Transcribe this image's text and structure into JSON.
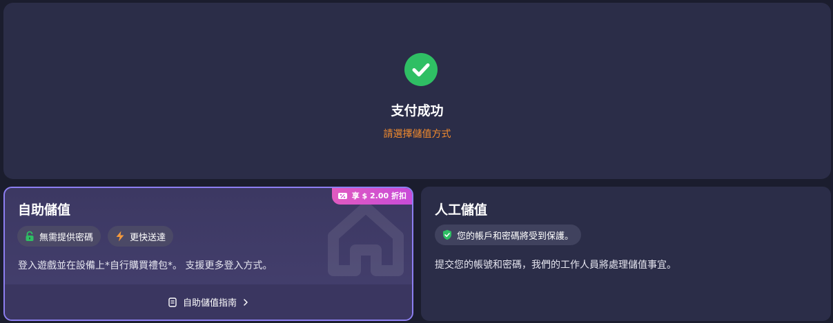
{
  "status": {
    "title": "支付成功",
    "subtitle": "請選擇儲值方式",
    "icon": "check-circle-icon",
    "success_color": "#2fbf64",
    "subtitle_color": "#f28b2e"
  },
  "self_topup": {
    "title": "自助儲值",
    "discount_badge": "享 $ 2.00 折扣",
    "discount_icon": "discount-ticket-icon",
    "features": [
      {
        "icon": "lock-icon",
        "label": "無需提供密碼"
      },
      {
        "icon": "lightning-icon",
        "label": "更快送達"
      }
    ],
    "description": "登入遊戲並在設備上*自行購買禮包*。 支援更多登入方式。",
    "guide_label": "自助儲值指南",
    "guide_icon": "document-icon",
    "accent_color": "#8d7ff2"
  },
  "manual_topup": {
    "title": "人工儲值",
    "features": [
      {
        "icon": "shield-check-icon",
        "label": "您的帳戶和密碼將受到保護。"
      }
    ],
    "description": "提交您的帳號和密碼，我們的工作人員將處理儲值事宜。"
  }
}
